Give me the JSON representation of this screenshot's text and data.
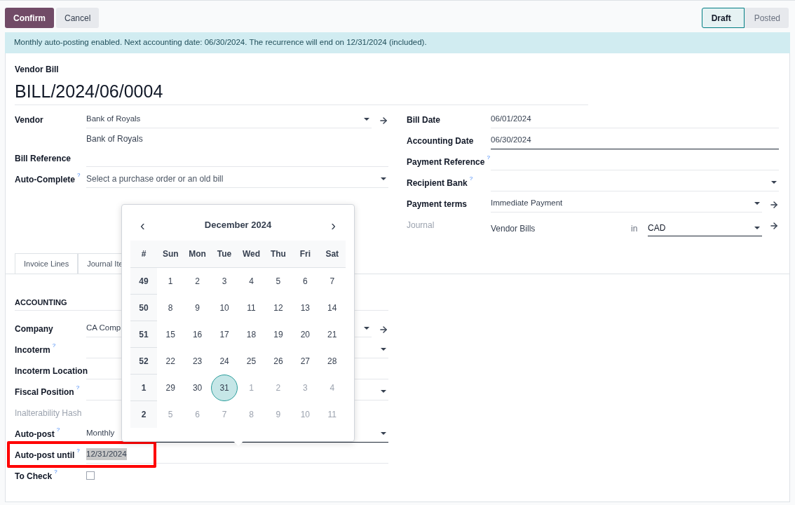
{
  "buttons": [
    {
      "label": "Confirm",
      "kind": "primary"
    },
    {
      "label": "Cancel",
      "kind": "secondary"
    }
  ],
  "status_steps": [
    {
      "label": "Draft",
      "selected": true
    },
    {
      "label": "Posted",
      "selected": false
    }
  ],
  "alert": "Monthly auto-posting enabled. Next accounting date: 06/30/2024. The recurrence will end on 12/31/2024 (included).",
  "record": {
    "type_label": "Vendor Bill",
    "name": "BILL/2024/06/0004"
  },
  "left_fields": [
    {
      "label": "Vendor",
      "kind": "select",
      "value": "Bank of Royals",
      "subtext": "Bank of Royals",
      "focused": false,
      "disabled": false,
      "link": true
    },
    {
      "label": "Bill Reference",
      "kind": "text",
      "focused": false,
      "disabled": false,
      "link": false
    },
    {
      "label": "Auto-Complete",
      "help": "?",
      "kind": "select",
      "placeholder": "Select a purchase order or an old bill",
      "focused": false,
      "disabled": false,
      "link": false
    }
  ],
  "right_fields": [
    {
      "label": "Bill Date",
      "kind": "text",
      "value": "06/01/2024",
      "focused": false,
      "disabled": false,
      "link": false
    },
    {
      "label": "Accounting Date",
      "kind": "text",
      "value": "06/30/2024",
      "focused": true,
      "disabled": false,
      "link": false
    },
    {
      "label": "Payment Reference",
      "help": "?",
      "kind": "text",
      "focused": false,
      "disabled": false,
      "link": false
    },
    {
      "label": "Recipient Bank",
      "help": "?",
      "kind": "select",
      "focused": false,
      "disabled": false,
      "link": false
    },
    {
      "label": "Payment terms",
      "kind": "select",
      "value": "Immediate Payment",
      "focused": false,
      "disabled": false,
      "link": true
    },
    {
      "label": "Journal",
      "kind": "journal",
      "value": "Vendor Bills",
      "connector": "in",
      "currency": "CAD",
      "focused": true,
      "disabled": true,
      "link": true
    }
  ],
  "tabs": [
    {
      "label": "Invoice Lines",
      "selected": false
    },
    {
      "label": "Journal Ite",
      "selected": false
    }
  ],
  "section_title": "ACCOUNTING",
  "accounting_fields": [
    {
      "label": "Company",
      "kind": "select",
      "value": "CA Comp",
      "focused": false,
      "disabled": false,
      "link": true,
      "highlighted": false
    },
    {
      "label": "Incoterm",
      "help": "?",
      "kind": "select",
      "focused": false,
      "disabled": false,
      "link": false,
      "highlighted": false
    },
    {
      "label": "Incoterm Location",
      "kind": "text",
      "focused": false,
      "disabled": false,
      "link": false,
      "highlighted": false
    },
    {
      "label": "Fiscal Position",
      "help": "?",
      "kind": "select",
      "focused": false,
      "disabled": false,
      "link": false,
      "highlighted": false
    },
    {
      "label": "Inalterability Hash",
      "kind": "readonly",
      "disabled": true,
      "link": false,
      "highlighted": false
    },
    {
      "label": "Auto-post",
      "help": "?",
      "kind": "select",
      "value": "Monthly",
      "focused": true,
      "disabled": false,
      "link": false,
      "highlighted": false
    },
    {
      "label": "Auto-post until",
      "help": "?",
      "kind": "text",
      "value": "12/31/2024",
      "selected_text": true,
      "focused": false,
      "disabled": false,
      "link": false,
      "highlighted": true
    },
    {
      "label": "To Check",
      "help": "?",
      "kind": "checkbox",
      "checked": false,
      "disabled": false,
      "link": false,
      "highlighted": false
    }
  ],
  "calendar": {
    "prev": "‹",
    "next": "›",
    "title": "December 2024",
    "week_heading": "#",
    "weekdays": [
      "Sun",
      "Mon",
      "Tue",
      "Wed",
      "Thu",
      "Fri",
      "Sat"
    ],
    "weeks": [
      {
        "number": "49",
        "days": [
          {
            "day": "1",
            "outside": false,
            "selected": false
          },
          {
            "day": "2",
            "outside": false,
            "selected": false
          },
          {
            "day": "3",
            "outside": false,
            "selected": false
          },
          {
            "day": "4",
            "outside": false,
            "selected": false
          },
          {
            "day": "5",
            "outside": false,
            "selected": false
          },
          {
            "day": "6",
            "outside": false,
            "selected": false
          },
          {
            "day": "7",
            "outside": false,
            "selected": false
          }
        ]
      },
      {
        "number": "50",
        "days": [
          {
            "day": "8",
            "outside": false,
            "selected": false
          },
          {
            "day": "9",
            "outside": false,
            "selected": false
          },
          {
            "day": "10",
            "outside": false,
            "selected": false
          },
          {
            "day": "11",
            "outside": false,
            "selected": false
          },
          {
            "day": "12",
            "outside": false,
            "selected": false
          },
          {
            "day": "13",
            "outside": false,
            "selected": false
          },
          {
            "day": "14",
            "outside": false,
            "selected": false
          }
        ]
      },
      {
        "number": "51",
        "days": [
          {
            "day": "15",
            "outside": false,
            "selected": false
          },
          {
            "day": "16",
            "outside": false,
            "selected": false
          },
          {
            "day": "17",
            "outside": false,
            "selected": false
          },
          {
            "day": "18",
            "outside": false,
            "selected": false
          },
          {
            "day": "19",
            "outside": false,
            "selected": false
          },
          {
            "day": "20",
            "outside": false,
            "selected": false
          },
          {
            "day": "21",
            "outside": false,
            "selected": false
          }
        ]
      },
      {
        "number": "52",
        "days": [
          {
            "day": "22",
            "outside": false,
            "selected": false
          },
          {
            "day": "23",
            "outside": false,
            "selected": false
          },
          {
            "day": "24",
            "outside": false,
            "selected": false
          },
          {
            "day": "25",
            "outside": false,
            "selected": false
          },
          {
            "day": "26",
            "outside": false,
            "selected": false
          },
          {
            "day": "27",
            "outside": false,
            "selected": false
          },
          {
            "day": "28",
            "outside": false,
            "selected": false
          }
        ]
      },
      {
        "number": "1",
        "days": [
          {
            "day": "29",
            "outside": false,
            "selected": false
          },
          {
            "day": "30",
            "outside": false,
            "selected": false
          },
          {
            "day": "31",
            "outside": false,
            "selected": true
          },
          {
            "day": "1",
            "outside": true,
            "selected": false
          },
          {
            "day": "2",
            "outside": true,
            "selected": false
          },
          {
            "day": "3",
            "outside": true,
            "selected": false
          },
          {
            "day": "4",
            "outside": true,
            "selected": false
          }
        ]
      },
      {
        "number": "2",
        "days": [
          {
            "day": "5",
            "outside": true,
            "selected": false
          },
          {
            "day": "6",
            "outside": true,
            "selected": false
          },
          {
            "day": "7",
            "outside": true,
            "selected": false
          },
          {
            "day": "8",
            "outside": true,
            "selected": false
          },
          {
            "day": "9",
            "outside": true,
            "selected": false
          },
          {
            "day": "10",
            "outside": true,
            "selected": false
          },
          {
            "day": "11",
            "outside": true,
            "selected": false
          }
        ]
      }
    ]
  }
}
